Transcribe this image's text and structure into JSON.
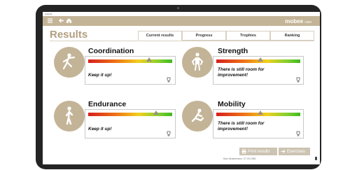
{
  "status_bar": {
    "left": "Android",
    "center": "",
    "right": ""
  },
  "header": {
    "brand": "mobee",
    "brand_suffix": "care",
    "menu_icon": "menu-icon",
    "back_icon": "back-arrow-icon",
    "home_icon": "home-icon"
  },
  "page_title": "Results",
  "tabs": [
    {
      "label": "Current results",
      "active": true
    },
    {
      "label": "Progress",
      "active": false
    },
    {
      "label": "Trophies",
      "active": false
    },
    {
      "label": "Ranking",
      "active": false
    }
  ],
  "cards": [
    {
      "name": "Coordination",
      "message": "Keep it up!",
      "score_level": 0.64,
      "icon": "coordination-figure-icon"
    },
    {
      "name": "Strength",
      "message": "There is still room for improvement!",
      "score_level": 0.45,
      "icon": "strength-figure-icon"
    },
    {
      "name": "Endurance",
      "message": "Keep it up!",
      "score_level": 0.72,
      "icon": "endurance-figure-icon"
    },
    {
      "name": "Mobility",
      "message": "There is still room for improvement!",
      "score_level": 0.45,
      "icon": "mobility-figure-icon"
    }
  ],
  "actions": {
    "print_label": "Print results",
    "exercises_label": "Exercises"
  },
  "footer": "Max Mustermann, 07.09.1980"
}
